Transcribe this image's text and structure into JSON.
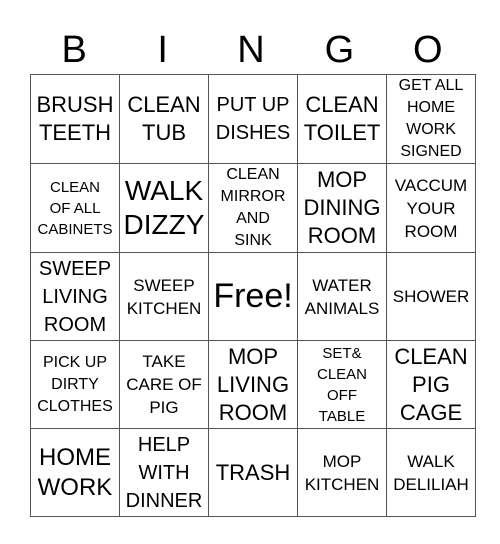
{
  "header": [
    "B",
    "I",
    "N",
    "G",
    "O"
  ],
  "rows": [
    [
      "BRUSH\nTEETH",
      "CLEAN\nTUB",
      "PUT UP\nDISHES",
      "CLEAN\nTOILET",
      "GET ALL\nHOME\nWORK\nSIGNED"
    ],
    [
      "CLEAN\nOF ALL\nCABINETS",
      "WALK\nDIZZY",
      "CLEAN\nMIRROR\nAND\nSINK",
      "MOP\nDINING\nROOM",
      "VACCUM\nYOUR\nROOM"
    ],
    [
      "SWEEP\nLIVING\nROOM",
      "SWEEP\nKITCHEN",
      "Free!",
      "WATER\nANIMALS",
      "SHOWER"
    ],
    [
      "PICK UP\nDIRTY\nCLOTHES",
      "TAKE\nCARE OF\nPIG",
      "MOP\nLIVING\nROOM",
      "SET&\nCLEAN\nOFF\nTABLE",
      "CLEAN\nPIG\nCAGE"
    ],
    [
      "HOME\nWORK",
      "HELP\nWITH\nDINNER",
      "TRASH",
      "MOP\nKITCHEN",
      "WALK\nDELILIAH"
    ]
  ]
}
